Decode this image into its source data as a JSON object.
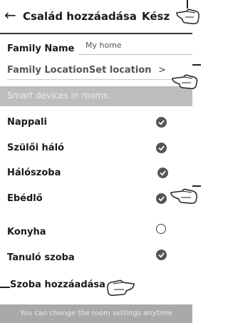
{
  "header": {
    "title": "Család hozzáadása",
    "done_label": "Kész",
    "back_icon": "back-arrow-icon"
  },
  "family_name": {
    "label": "Family Name",
    "value": "My home"
  },
  "family_location": {
    "label": "Family LocationSet location",
    "arrow": ">"
  },
  "section_title": "Smart devices in rooms:",
  "rooms": [
    {
      "name": "Nappali",
      "checked": true
    },
    {
      "name": "Szülői háló",
      "checked": true
    },
    {
      "name": "Hálószoba",
      "checked": true
    },
    {
      "name": "Ebédlő",
      "checked": true
    },
    {
      "name": "Konyha",
      "checked": false
    },
    {
      "name": "Tanuló szoba",
      "checked": true
    }
  ],
  "add_room_label": "Szoba hozzáadása",
  "footer_text": "You can change the room settings anytime"
}
